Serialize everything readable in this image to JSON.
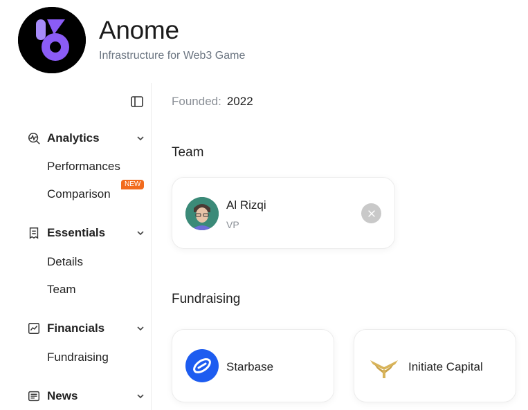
{
  "header": {
    "title": "Anome",
    "subtitle": "Infrastructure for Web3 Game",
    "logo_icon": "anome-logo-icon"
  },
  "sidebar": {
    "collapse_icon": "sidebar-toggle-icon",
    "sections": [
      {
        "label": "Analytics",
        "icon": "analytics-icon",
        "items": [
          {
            "label": "Performances"
          },
          {
            "label": "Comparison",
            "badge": "NEW"
          }
        ]
      },
      {
        "label": "Essentials",
        "icon": "receipt-icon",
        "items": [
          {
            "label": "Details"
          },
          {
            "label": "Team"
          }
        ]
      },
      {
        "label": "Financials",
        "icon": "chart-line-icon",
        "items": [
          {
            "label": "Fundraising"
          }
        ]
      },
      {
        "label": "News",
        "icon": "newspaper-icon",
        "items": []
      }
    ]
  },
  "main": {
    "founded": {
      "label": "Founded:",
      "value": "2022"
    },
    "team": {
      "title": "Team",
      "members": [
        {
          "name": "Al Rizqi",
          "role": "VP",
          "social_icon": "x-twitter-icon"
        }
      ]
    },
    "fundraising": {
      "title": "Fundraising",
      "investors": [
        {
          "name": "Starbase",
          "icon": "starbase-logo-icon"
        },
        {
          "name": "Initiate Capital",
          "icon": "initiate-capital-logo-icon"
        }
      ]
    }
  },
  "colors": {
    "brand_purple": "#8b5cf6",
    "badge_orange": "#f26b1d",
    "starbase_blue": "#1d5cf0",
    "initiate_gold": "#d8b45a"
  }
}
